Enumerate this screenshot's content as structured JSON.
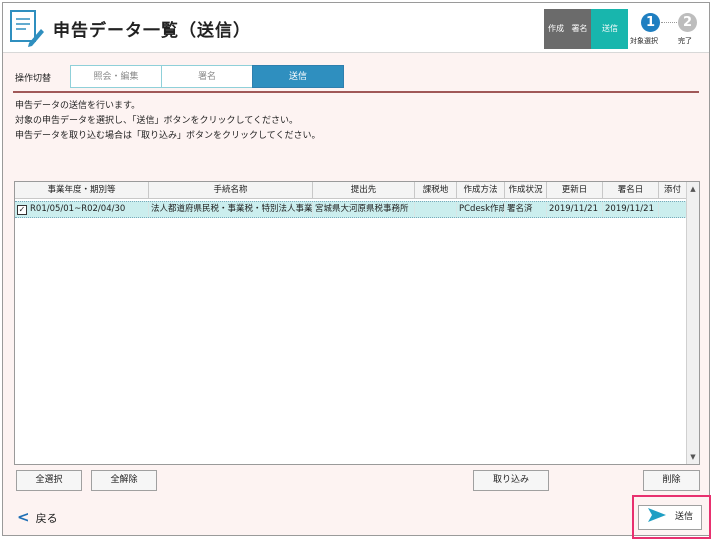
{
  "header": {
    "title": "申告データ一覧（送信）",
    "step_tabs": [
      "作成",
      "署名",
      "送信"
    ],
    "progress": {
      "steps": [
        {
          "number": "1",
          "caption": "対象選択"
        },
        {
          "number": "2",
          "caption": "完了"
        }
      ]
    }
  },
  "mode": {
    "label": "操作切替",
    "tabs": [
      "照会・編集",
      "署名",
      "送信"
    ],
    "active": "送信"
  },
  "instructions": [
    "申告データの送信を行います。",
    "対象の申告データを選択し、「送信」ボタンをクリックしてください。",
    "申告データを取り込む場合は「取り込み」ボタンをクリックしてください。"
  ],
  "table": {
    "columns": [
      "事業年度・期別等",
      "手続名称",
      "提出先",
      "課税地",
      "作成方法",
      "作成状況",
      "更新日",
      "署名日",
      "添付"
    ],
    "rows": [
      {
        "checked": true,
        "cells": [
          "R01/05/01~R02/04/30",
          "法人都道府県民税・事業税・特別法人事業税",
          "宮城県大河原県税事務所",
          "",
          "PCdesk作成",
          "署名済",
          "2019/11/21",
          "2019/11/21",
          ""
        ]
      }
    ]
  },
  "buttons": {
    "select_all": "全選択",
    "deselect_all": "全解除",
    "import": "取り込み",
    "delete": "削除",
    "back": "戻る",
    "send": "送信"
  },
  "colors": {
    "accent_teal": "#18b6ad",
    "active_tab_blue": "#2f8fbf",
    "highlight_pink": "#e8306f",
    "selected_row": "#cbeeee"
  }
}
